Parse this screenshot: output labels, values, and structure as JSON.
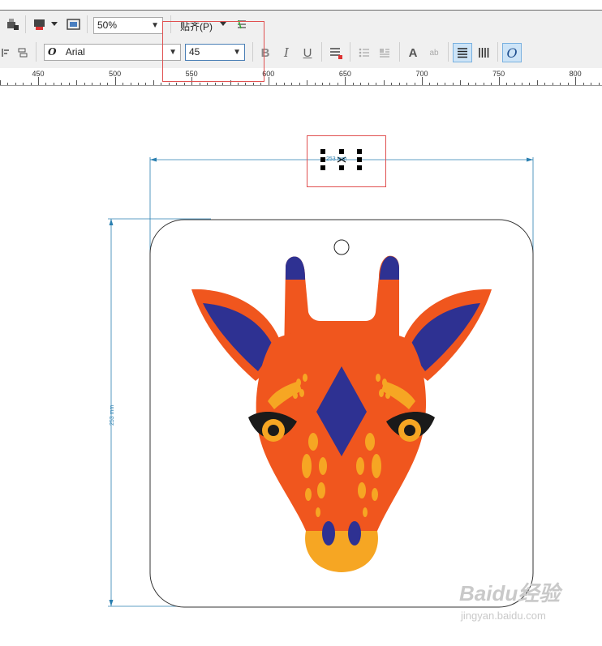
{
  "toolbar1": {
    "zoom_value": "50%",
    "snap_label": "贴齐(P)",
    "icons": [
      "print-merge-icon",
      "fill-icon",
      "view-icon",
      "snap-options-icon"
    ]
  },
  "toolbar2": {
    "font_name": "Arial",
    "font_size": "45",
    "font_icon_glyph": "O",
    "bold_glyph": "B",
    "italic_glyph": "I",
    "underline_glyph": "U",
    "text_icon_glyph": "A",
    "superscript_glyph": "ab",
    "italic_active_glyph": "O"
  },
  "ruler": {
    "labels": [
      "450",
      "500",
      "550",
      "600",
      "650",
      "700",
      "750",
      "800"
    ]
  },
  "canvas": {
    "vertical_dimension": "253 mm",
    "horizontal_dimension": "253 mm"
  },
  "watermark": {
    "brand": "Baidu经验",
    "url": "jingyan.baidu.com"
  },
  "colors": {
    "orange": "#f0561e",
    "blue": "#2e3192",
    "yellow": "#f6a623",
    "dark": "#1a1a1a",
    "guide": "#2a7fb0"
  }
}
